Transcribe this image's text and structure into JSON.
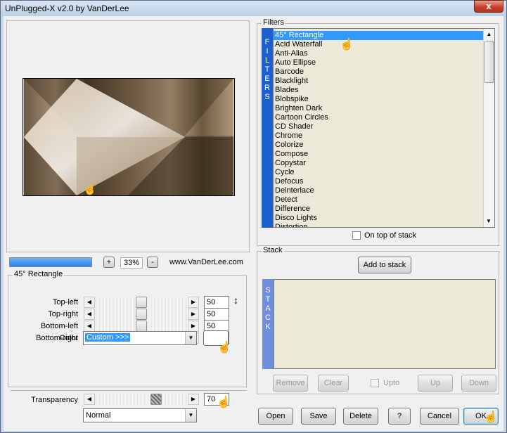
{
  "window": {
    "title": "UnPlugged-X v2.0 by VanDerLee",
    "close_glyph": "x"
  },
  "preview": {
    "zoom_minus": "-",
    "zoom_plus": "+",
    "zoom_value": "33%",
    "website": "www.VanDerLee.com"
  },
  "params": {
    "group_title": "45° Rectangle",
    "sliders": [
      {
        "label": "Top-left",
        "value": "50",
        "level": 0.5
      },
      {
        "label": "Top-right",
        "value": "50",
        "level": 0.5
      },
      {
        "label": "Bottom-left",
        "value": "50",
        "level": 0.5
      },
      {
        "label": "Bottom-right",
        "value": "50",
        "level": 0.5
      }
    ],
    "color_label": "Color",
    "color_value": "Custom >>>",
    "transparency_label": "Transparency",
    "transparency_value": "70",
    "transparency_level": 0.7,
    "blend_mode": "Normal"
  },
  "filters": {
    "group_title": "Filters",
    "side_letters": [
      "F",
      "I",
      "L",
      "T",
      "E",
      "R",
      "S"
    ],
    "items": [
      "45° Rectangle",
      "Acid Waterfall",
      "Anti-Alias",
      "Auto Ellipse",
      "Barcode",
      "Blacklight",
      "Blades",
      "Blobspike",
      "Brighten Dark",
      "Cartoon Circles",
      "CD Shader",
      "Chrome",
      "Colorize",
      "Compose",
      "Copystar",
      "Cycle",
      "Defocus",
      "Deinterlace",
      "Detect",
      "Difference",
      "Disco Lights",
      "Distortion"
    ],
    "on_top_label": "On top of stack"
  },
  "stack": {
    "group_title": "Stack",
    "add_label": "Add to stack",
    "side_letters": [
      "S",
      "T",
      "A",
      "C",
      "K"
    ],
    "remove_label": "Remove",
    "clear_label": "Clear",
    "upto_label": "Upto",
    "up_label": "Up",
    "down_label": "Down"
  },
  "footer": {
    "open": "Open",
    "save": "Save",
    "delete": "Delete",
    "help": "?",
    "cancel": "Cancel",
    "ok": "OK"
  },
  "colors": {
    "selection": "#3399ff",
    "filters_sidebar": "#1e5fd0",
    "stack_sidebar": "#6f8fdc",
    "list_background": "#ece9d8"
  }
}
